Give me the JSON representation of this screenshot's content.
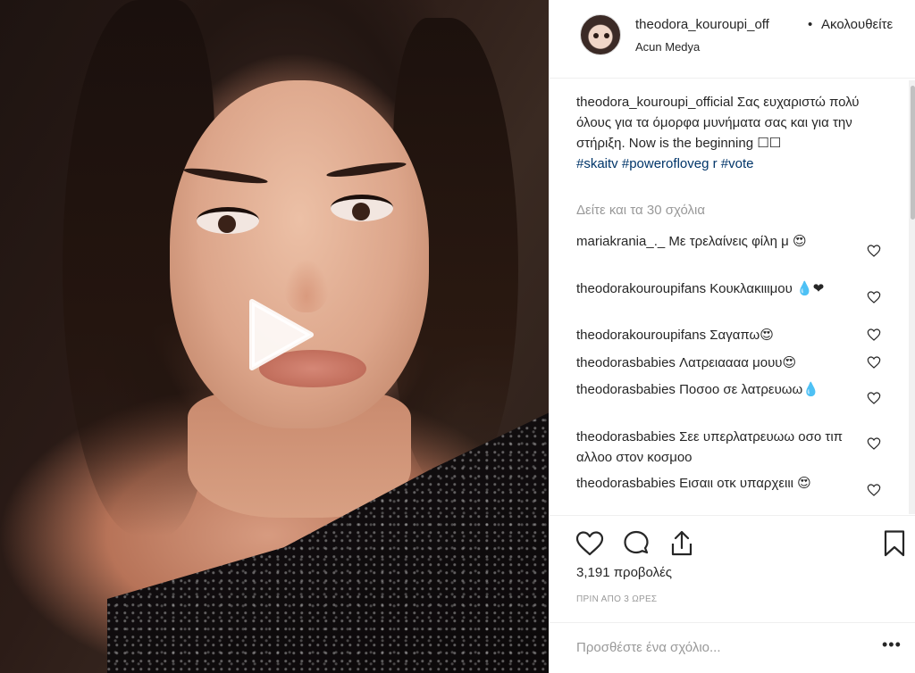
{
  "header": {
    "username": "theodora_kouroupi_off",
    "dot": "•",
    "follow_label": "Ακολουθείτε",
    "location": "Acun Medya"
  },
  "caption": {
    "username": "theodora_kouroupi_official",
    "text": "Σας ευχαριστώ πολύ όλους για τα όμορφα μυνήματα σας και για την στήριξη. Now is the beginning ☐☐",
    "hashtags": [
      "#skaitv",
      "#powerofloveg r",
      "#vote"
    ]
  },
  "view_all_comments": "Δείτε και τα 30 σχόλια",
  "comments": [
    {
      "username": "mariakrania_._",
      "text": "Με τρελαίνεις φίλη μ 😍"
    },
    {
      "username": "theodorakouroupifans",
      "text": "Κουκλακιιιμου 💧❤"
    },
    {
      "username": "theodorakouroupifans",
      "text": "Σαγαπω😍"
    },
    {
      "username": "theodorasbabies",
      "text": "Λατρειαααα μουυ😍"
    },
    {
      "username": "theodorasbabies",
      "text": "Ποσοο σε λατρευωω💧"
    },
    {
      "username": "theodorasbabies",
      "text": "Σεε υπερλατρευωω οσο τιπ αλλοο στον κοσμοο"
    },
    {
      "username": "theodorasbabies",
      "text": "Εισαιι οτκ υπαρχειιι 😍"
    }
  ],
  "icons": {
    "like": "heart-icon",
    "comment": "comment-bubble-icon",
    "share": "share-icon",
    "save": "bookmark-icon",
    "play": "play-icon",
    "more": "more-options-icon"
  },
  "views": "3,191 προβολές",
  "timestamp": "ΠΡΙΝ ΑΠΟ 3 ΩΡΕΣ",
  "add_comment": {
    "placeholder": "Προσθέστε ένα σχόλιο...",
    "more_label": "•••"
  },
  "colors": {
    "hashtag": "#003569",
    "muted": "#999999",
    "text": "#262626",
    "border": "#efefef"
  }
}
